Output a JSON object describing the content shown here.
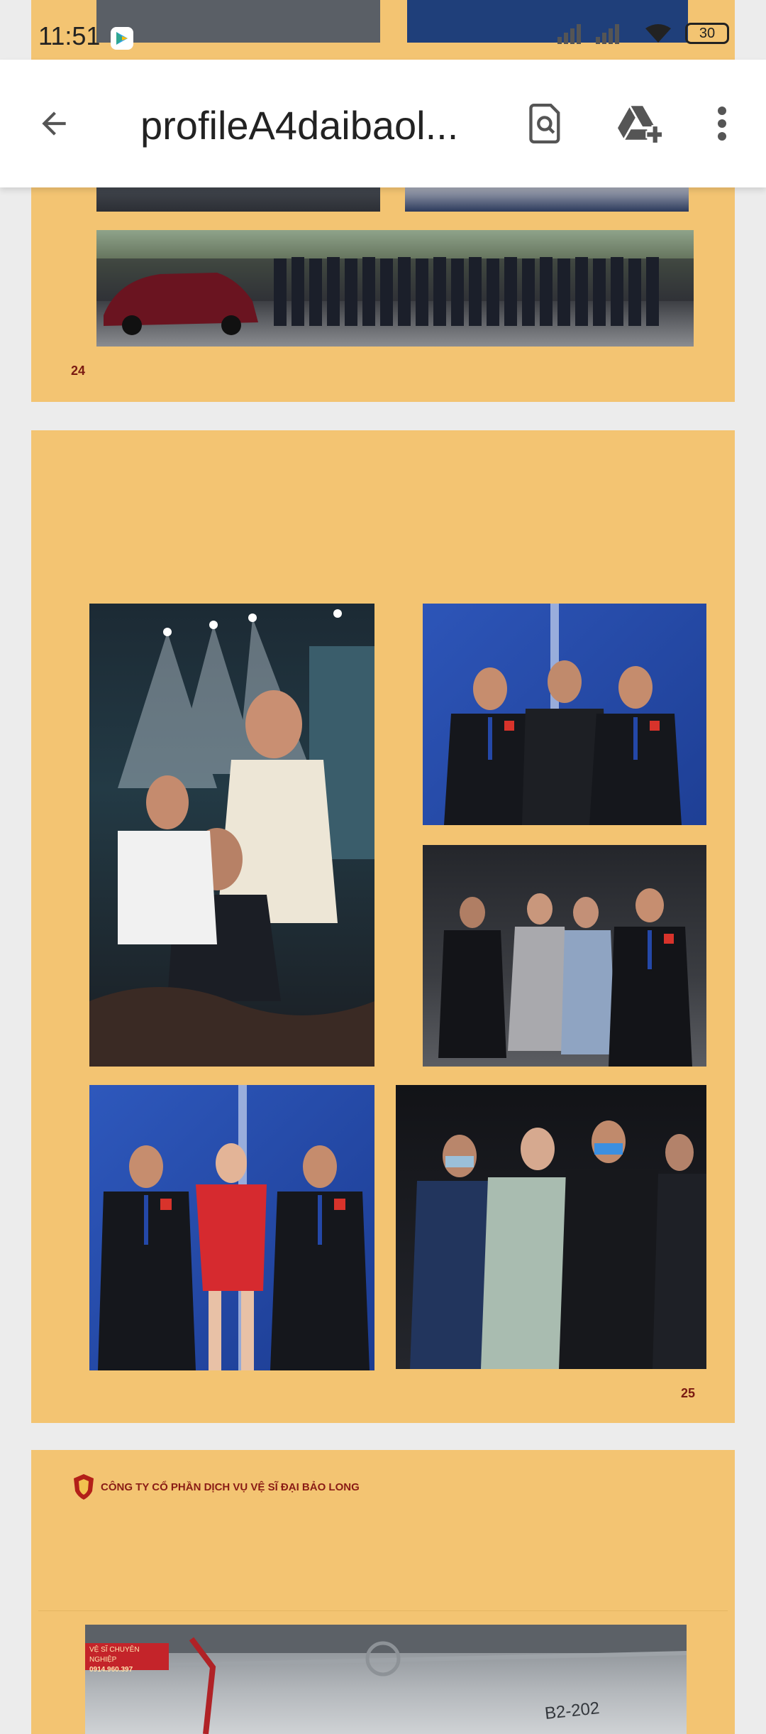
{
  "status_bar": {
    "time": "11:51",
    "battery": "30"
  },
  "app_bar": {
    "title": "profileA4daibaol..."
  },
  "pages": {
    "p24": {
      "number": "24"
    },
    "p25": {
      "number": "25"
    },
    "p26": {
      "company": "CÔNG TY CỔ PHẦN DỊCH VỤ VỆ SĨ ĐẠI BẢO LONG",
      "sign_line1": "VỆ SĨ CHUYÊN NGHIỆP",
      "sign_line2": "0914.960.397",
      "parking_label": "B2-202"
    }
  },
  "icons": [
    "back-arrow-icon",
    "find-in-page-icon",
    "add-to-drive-icon",
    "more-vert-icon",
    "wifi-icon",
    "battery-icon",
    "signal-icon",
    "play-store-icon"
  ]
}
